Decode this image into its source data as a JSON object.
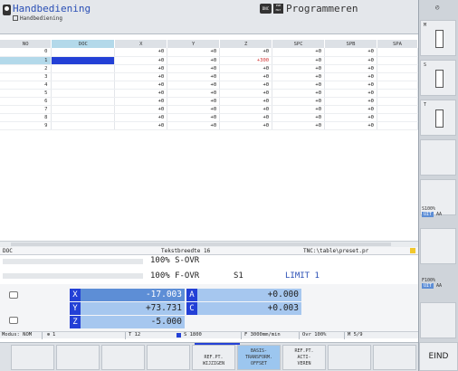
{
  "header": {
    "mode_title": "Handbediening",
    "mode_subtitle": "Handbediening",
    "dnc": "DNC",
    "pgm_icon": "PGM MGT",
    "program_title": "Programmeren"
  },
  "table": {
    "columns": [
      "NO",
      "DOC",
      "X",
      "Y",
      "Z",
      "SPC",
      "SPB",
      "SPA"
    ],
    "rows": [
      [
        "0",
        "",
        "+0",
        "+0",
        "+0",
        "+0",
        "+0",
        ""
      ],
      [
        "1",
        "",
        "+0",
        "+0",
        "+300",
        "+0",
        "+0",
        ""
      ],
      [
        "2",
        "",
        "+0",
        "+0",
        "+0",
        "+0",
        "+0",
        ""
      ],
      [
        "3",
        "",
        "+0",
        "+0",
        "+0",
        "+0",
        "+0",
        ""
      ],
      [
        "4",
        "",
        "+0",
        "+0",
        "+0",
        "+0",
        "+0",
        ""
      ],
      [
        "5",
        "",
        "+0",
        "+0",
        "+0",
        "+0",
        "+0",
        ""
      ],
      [
        "6",
        "",
        "+0",
        "+0",
        "+0",
        "+0",
        "+0",
        ""
      ],
      [
        "7",
        "",
        "+0",
        "+0",
        "+0",
        "+0",
        "+0",
        ""
      ],
      [
        "8",
        "",
        "+0",
        "+0",
        "+0",
        "+0",
        "+0",
        ""
      ],
      [
        "9",
        "",
        "+0",
        "+0",
        "+0",
        "+0",
        "+0",
        ""
      ]
    ],
    "selected_row": 1
  },
  "status": {
    "field": "DOC",
    "text_width": "Tekstbreedte 16",
    "path": "TNC:\\table\\preset.pr"
  },
  "overrides": {
    "s_ovr": "100% S-OVR",
    "f_ovr": "100% F-OVR",
    "s1": "S1",
    "limit": "LIMIT 1"
  },
  "positions": {
    "x_label": "X",
    "x_value": "-17.003",
    "a_label": "A",
    "a_value": "+0.000",
    "y_label": "Y",
    "y_value": "+73.731",
    "c_label": "C",
    "c_value": "+0.003",
    "z_label": "Z",
    "z_value": "-5.000"
  },
  "info": {
    "mode": "Modus: NOM",
    "tool": "1",
    "t": "T 12",
    "s": "S 1800",
    "f": "F 3000mm/min",
    "ovr": "Ovr 100%",
    "m": "M 5/9"
  },
  "softkeys": {
    "sk5_line1": "REF.PT.",
    "sk5_line2": "WIJZIGEN",
    "sk6_line1": "BASIS-",
    "sk6_line2": "TRANSFORM.",
    "sk6_line3": "OFFSET",
    "sk7_line1": "REF.PT.",
    "sk7_line2": "ACTI-",
    "sk7_line3": "VEREN",
    "end": "EIND"
  },
  "side": {
    "m": "M",
    "s": "S",
    "t": "T",
    "s100": "S100%",
    "f100": "F100%",
    "uit": "UIT",
    "aa": "AA"
  },
  "colors": {
    "accent_blue": "#2340d6",
    "selection": "#b3d9ea",
    "title_blue": "#2a4fb5"
  }
}
